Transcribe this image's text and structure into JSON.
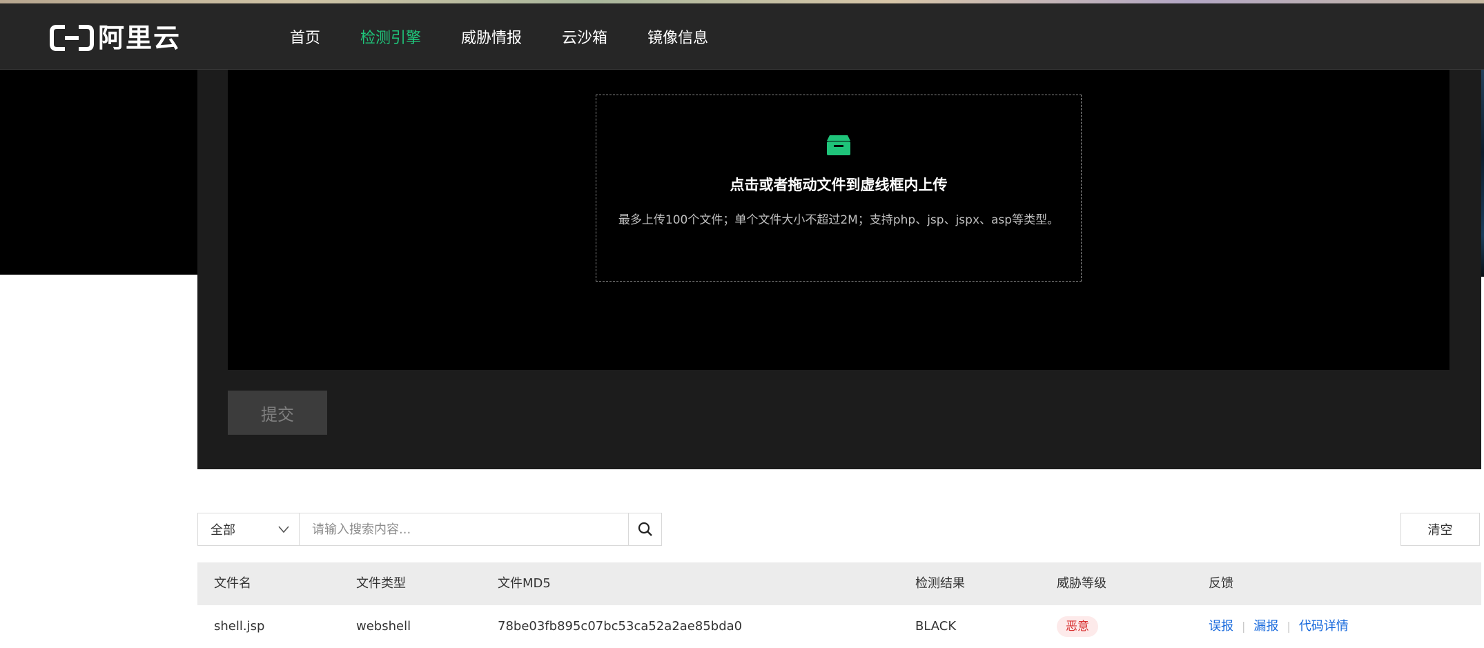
{
  "header": {
    "logo_text": "阿里云",
    "nav": [
      {
        "label": "首页",
        "active": false
      },
      {
        "label": "检测引擎",
        "active": true
      },
      {
        "label": "威胁情报",
        "active": false
      },
      {
        "label": "云沙箱",
        "active": false
      },
      {
        "label": "镜像信息",
        "active": false
      }
    ]
  },
  "upload": {
    "icon": "inbox-icon",
    "title": "点击或者拖动文件到虚线框内上传",
    "hint": "最多上传100个文件；单个文件大小不超过2M；支持php、jsp、jspx、asp等类型。",
    "submit_label": "提交"
  },
  "filter": {
    "select_value": "全部",
    "search_placeholder": "请输入搜索内容...",
    "clear_label": "清空"
  },
  "table": {
    "headers": [
      "文件名",
      "文件类型",
      "文件MD5",
      "检测结果",
      "威胁等级",
      "反馈"
    ],
    "rows": [
      {
        "file_name": "shell.jsp",
        "file_type": "webshell",
        "md5": "78be03fb895c07bc53ca52a2ae85bda0",
        "result": "BLACK",
        "threat_level": "恶意",
        "feedback": [
          "误报",
          "漏报",
          "代码详情"
        ]
      }
    ]
  },
  "colors": {
    "accent": "#1fc47a",
    "nav_bg": "#262626",
    "danger": "#d83030",
    "link": "#1668dc"
  }
}
